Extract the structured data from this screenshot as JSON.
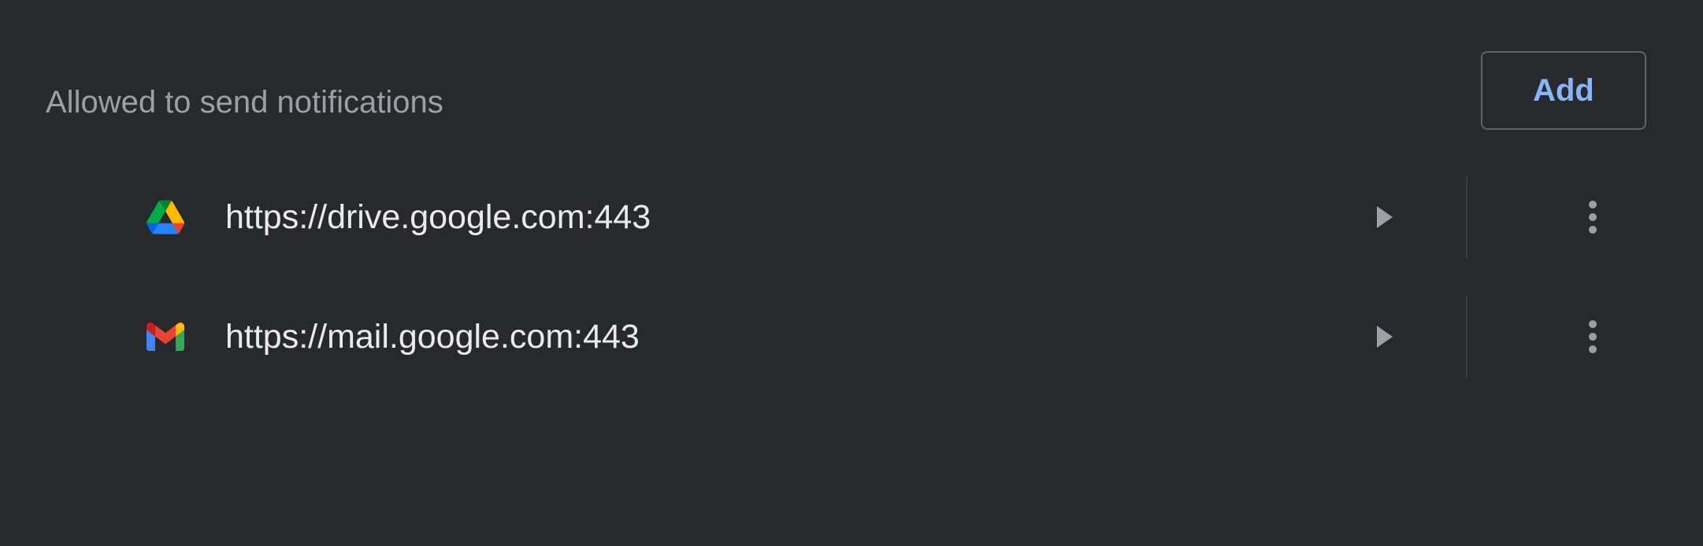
{
  "section": {
    "title": "Allowed to send notifications",
    "add_label": "Add"
  },
  "sites": [
    {
      "url": "https://drive.google.com:443",
      "icon": "google-drive-icon"
    },
    {
      "url": "https://mail.google.com:443",
      "icon": "gmail-icon"
    }
  ],
  "colors": {
    "background": "#28292d",
    "accent": "#8ab4f8",
    "text_primary": "#e8eaed",
    "text_secondary": "#9aa0a6"
  }
}
